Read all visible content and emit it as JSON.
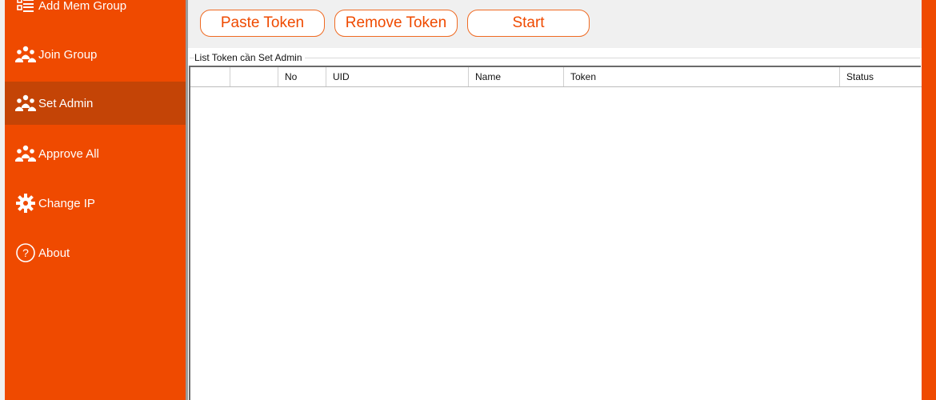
{
  "sidebar": {
    "items": [
      {
        "label": "Add Mem Group",
        "icon": "list-add-icon",
        "active": false
      },
      {
        "label": "Join Group",
        "icon": "group-users-icon",
        "active": false
      },
      {
        "label": "Set Admin",
        "icon": "group-users-icon",
        "active": true
      },
      {
        "label": "Approve All",
        "icon": "group-users-icon",
        "active": false
      },
      {
        "label": "Change IP",
        "icon": "gear-icon",
        "active": false
      },
      {
        "label": "About",
        "icon": "question-circle-icon",
        "active": false
      }
    ]
  },
  "toolbar": {
    "paste_label": "Paste Token",
    "remove_label": "Remove Token",
    "start_label": "Start"
  },
  "group": {
    "title": "List Token cần Set Admin"
  },
  "table": {
    "columns": [
      "",
      "",
      "No",
      "UID",
      "Name",
      "Token",
      "Status"
    ],
    "rows": []
  },
  "colors": {
    "accent": "#ef4a00",
    "active_item": "#c44406",
    "button_text": "#ef4a00",
    "toolbar_bg": "#f0f0f0"
  }
}
